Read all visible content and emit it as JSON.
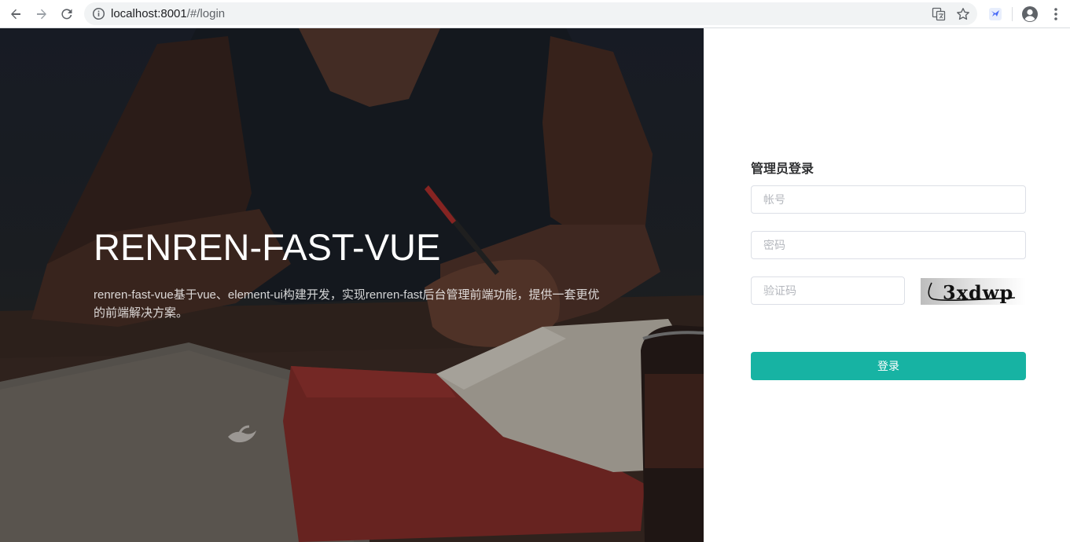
{
  "browser": {
    "url_host": "localhost:8001",
    "url_path": "/#/login",
    "icons": [
      "back-icon",
      "forward-icon",
      "reload-icon",
      "info-icon",
      "translate-icon",
      "star-icon",
      "extension-icon",
      "profile-icon",
      "menu-icon"
    ]
  },
  "hero": {
    "title": "RENREN-FAST-VUE",
    "description": "renren-fast-vue基于vue、element-ui构建开发，实现renren-fast后台管理前端功能，提供一套更优的前端解决方案。"
  },
  "login": {
    "title": "管理员登录",
    "username_placeholder": "帐号",
    "password_placeholder": "密码",
    "captcha_placeholder": "验证码",
    "captcha_text": "3xdwp",
    "submit_label": "登录"
  },
  "colors": {
    "accent": "#17b3a3",
    "border": "#dcdfe6",
    "hero_bg": "#23272d"
  }
}
